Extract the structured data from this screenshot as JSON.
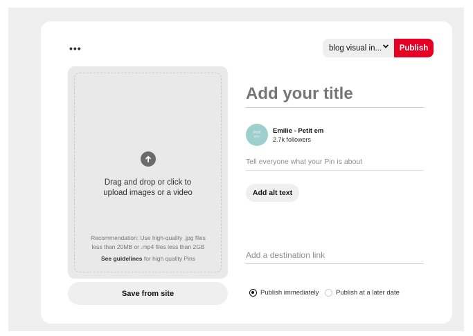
{
  "header": {
    "more_label": "•••",
    "board_select": "blog visual in...",
    "publish_label": "Publish",
    "publish_color": "#e60023"
  },
  "upload": {
    "drag_line1": "Drag and drop or click to",
    "drag_line2": "upload images or a video",
    "recommendation_line1": "Recommendation: Use high-quality .jpg files",
    "recommendation_line2": "less than 20MB or .mp4 files less than 2GB",
    "guidelines_link": "See guidelines",
    "guidelines_suffix": " for high quality Pins",
    "icon": "upload-arrow-icon"
  },
  "save_from_site": "Save from site",
  "pin": {
    "title_placeholder": "Add your title",
    "user_name": "Emilie - Petit em",
    "followers": "2.7k followers",
    "avatar_text_1": "Petit",
    "avatar_text_2": "em",
    "description_placeholder": "Tell everyone what your Pin is about",
    "alt_text_button": "Add alt text",
    "destination_placeholder": "Add a destination link"
  },
  "publish_options": {
    "immediately": "Publish immediately",
    "later": "Publish at a later date",
    "selected": "immediately"
  }
}
